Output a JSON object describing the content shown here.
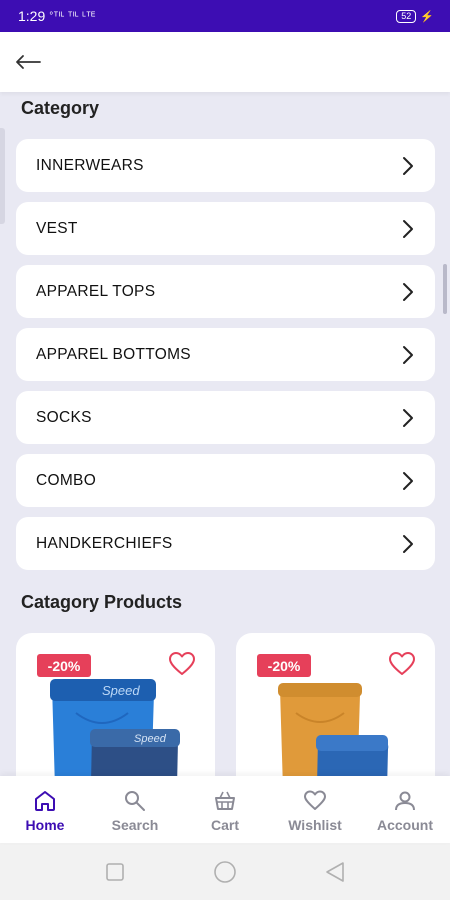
{
  "status_bar": {
    "time": "1:29",
    "network": "°ᵀᴵᴸ ᵀᴵᴸ ᴸᵀᴱ",
    "battery": "52"
  },
  "colors": {
    "primary": "#3d0db3",
    "discount": "#e6405a",
    "background": "#e9e9f3"
  },
  "header": {
    "back_icon": "arrow-left-icon"
  },
  "category": {
    "title": "Category",
    "items": [
      {
        "label": "INNERWEARS"
      },
      {
        "label": "VEST"
      },
      {
        "label": "APPAREL TOPS"
      },
      {
        "label": "APPAREL BOTTOMS"
      },
      {
        "label": "SOCKS"
      },
      {
        "label": "COMBO"
      },
      {
        "label": "HANDKERCHIEFS"
      }
    ]
  },
  "products": {
    "title": "Catagory Products",
    "items": [
      {
        "discount": "-20%",
        "color": "blue"
      },
      {
        "discount": "-20%",
        "color": "mustard"
      }
    ]
  },
  "bottom_nav": {
    "items": [
      {
        "label": "Home",
        "icon": "home-icon",
        "active": true
      },
      {
        "label": "Search",
        "icon": "search-icon",
        "active": false
      },
      {
        "label": "Cart",
        "icon": "cart-icon",
        "active": false
      },
      {
        "label": "Wishlist",
        "icon": "heart-icon",
        "active": false
      },
      {
        "label": "Account",
        "icon": "user-icon",
        "active": false
      }
    ]
  },
  "system_nav": {
    "icons": [
      "square-icon",
      "circle-icon",
      "triangle-back-icon"
    ]
  }
}
